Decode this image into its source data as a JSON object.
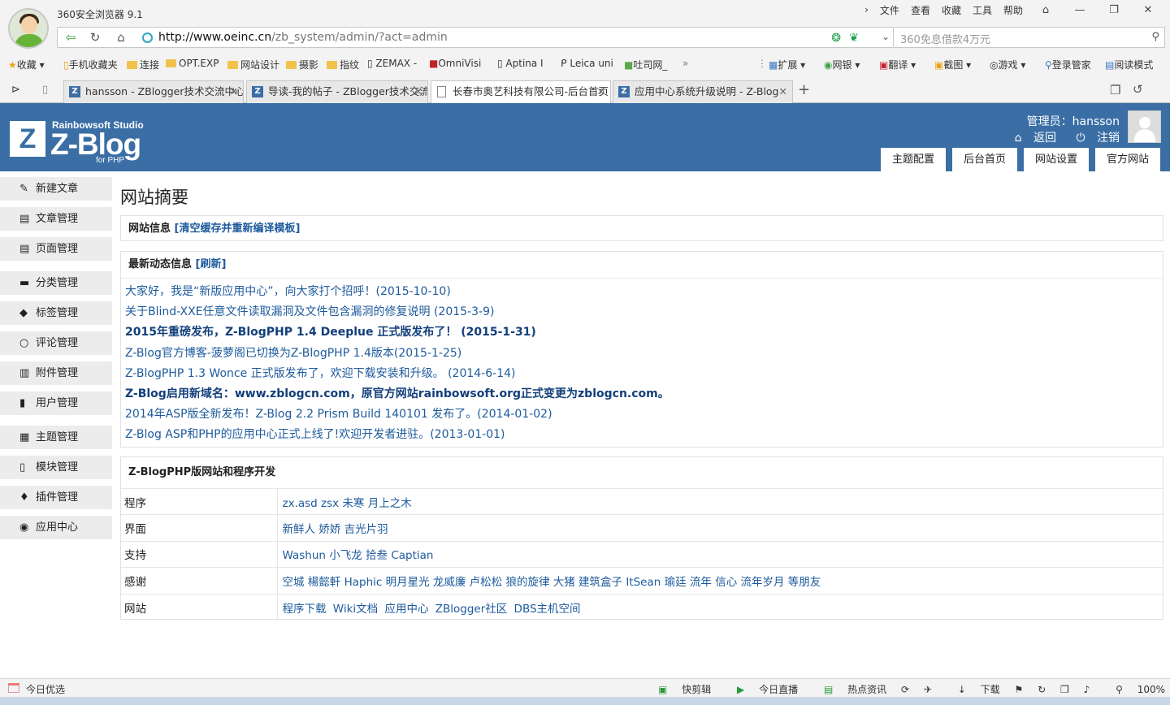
{
  "browser": {
    "app_name": "360安全浏览器 9.1",
    "menu": [
      "文件",
      "查看",
      "收藏",
      "工具",
      "帮助"
    ],
    "url_host": "http://www.oeinc.cn",
    "url_path": "/zb_system/admin/?act=admin",
    "search_placeholder": "360免息借款4万元",
    "bookmarks": [
      "收藏",
      "手机收藏夹",
      "连接",
      "OPT.EXP",
      "网站设计",
      "摄影",
      "指纹",
      "ZEMAX -",
      "OmniVisi",
      "Aptina I",
      "Leica uni",
      "吐司网_"
    ],
    "extensions": [
      "扩展",
      "网银",
      "翻译",
      "截图",
      "游戏",
      "登录管家",
      "阅读模式"
    ],
    "tabs": [
      {
        "title": "hansson - ZBlogger技术交流中心"
      },
      {
        "title": "导读-我的帖子 - ZBlogger技术交流"
      },
      {
        "title": "长春市奥艺科技有限公司-后台首页"
      },
      {
        "title": "应用中心系统升级说明 - Z-Blog"
      }
    ],
    "status_left": "今日优选",
    "status_right": [
      "快剪辑",
      "今日直播",
      "热点资讯",
      "下载",
      "100%"
    ]
  },
  "header": {
    "logo_letter": "Z",
    "logo_studio": "Rainbowsoft Studio",
    "logo_name": "Z-Blog",
    "logo_php": "for PHP",
    "admin_label": "管理员：hansson",
    "back_label": "返回",
    "logout_label": "注销",
    "tabs": [
      "主题配置",
      "后台首页",
      "网站设置",
      "官方网站"
    ]
  },
  "sidebar": {
    "items": [
      {
        "label": "新建文章",
        "icon": "✎"
      },
      {
        "label": "文章管理",
        "icon": "▤"
      },
      {
        "label": "页面管理",
        "icon": "▤"
      },
      {
        "label": "分类管理",
        "icon": "▬"
      },
      {
        "label": "标签管理",
        "icon": "◆"
      },
      {
        "label": "评论管理",
        "icon": "○"
      },
      {
        "label": "附件管理",
        "icon": "▥"
      },
      {
        "label": "用户管理",
        "icon": "▮"
      },
      {
        "label": "主题管理",
        "icon": "▦"
      },
      {
        "label": "模块管理",
        "icon": "▯"
      },
      {
        "label": "插件管理",
        "icon": "♦"
      },
      {
        "label": "应用中心",
        "icon": "◉"
      }
    ]
  },
  "main": {
    "title": "网站摘要",
    "site_info_label": "网站信息",
    "site_info_link": "[清空缓存并重新编译模板]",
    "news_label": "最新动态信息",
    "news_refresh": "[刷新]",
    "news": [
      "大家好，我是“新版应用中心”，向大家打个招呼！(2015-10-10)",
      "关于Blind-XXE任意文件读取漏洞及文件包含漏洞的修复说明 (2015-3-9)",
      "2015年重磅发布，Z-BlogPHP 1.4 Deeplue 正式版发布了！ (2015-1-31)",
      "Z-Blog官方博客-菠萝阁已切换为Z-BlogPHP 1.4版本(2015-1-25)",
      "Z-BlogPHP 1.3 Wonce 正式版发布了，欢迎下载安装和升级。 (2014-6-14)",
      "Z-Blog启用新域名：www.zblogcn.com，原官方网站rainbowsoft.org正式变更为zblogcn.com。",
      "2014年ASP版全新发布！Z-Blog 2.2 Prism Build 140101 发布了。(2014-01-02)",
      "Z-Blog ASP和PHP的应用中心正式上线了!欢迎开发者进驻。(2013-01-01)"
    ],
    "credits_title": "Z-BlogPHP版网站和程序开发",
    "credits": [
      {
        "key": "程序",
        "value": "zx.asd zsx 未寒 月上之木"
      },
      {
        "key": "界面",
        "value": "新鲜人 娇娇 吉光片羽"
      },
      {
        "key": "支持",
        "value": "Washun 小飞龙 拾叁 Captian"
      },
      {
        "key": "感谢",
        "value": "空城 楊懿軒 Haphic 明月星光 龙威廉 卢松松 狼的旋律 大猪 建筑盒子 ItSean 瑜廷 流年 信心 流年岁月 等朋友"
      },
      {
        "key": "网站",
        "value": "程序下载  Wiki文档  应用中心  ZBlogger社区  DBS主机空间"
      }
    ]
  }
}
